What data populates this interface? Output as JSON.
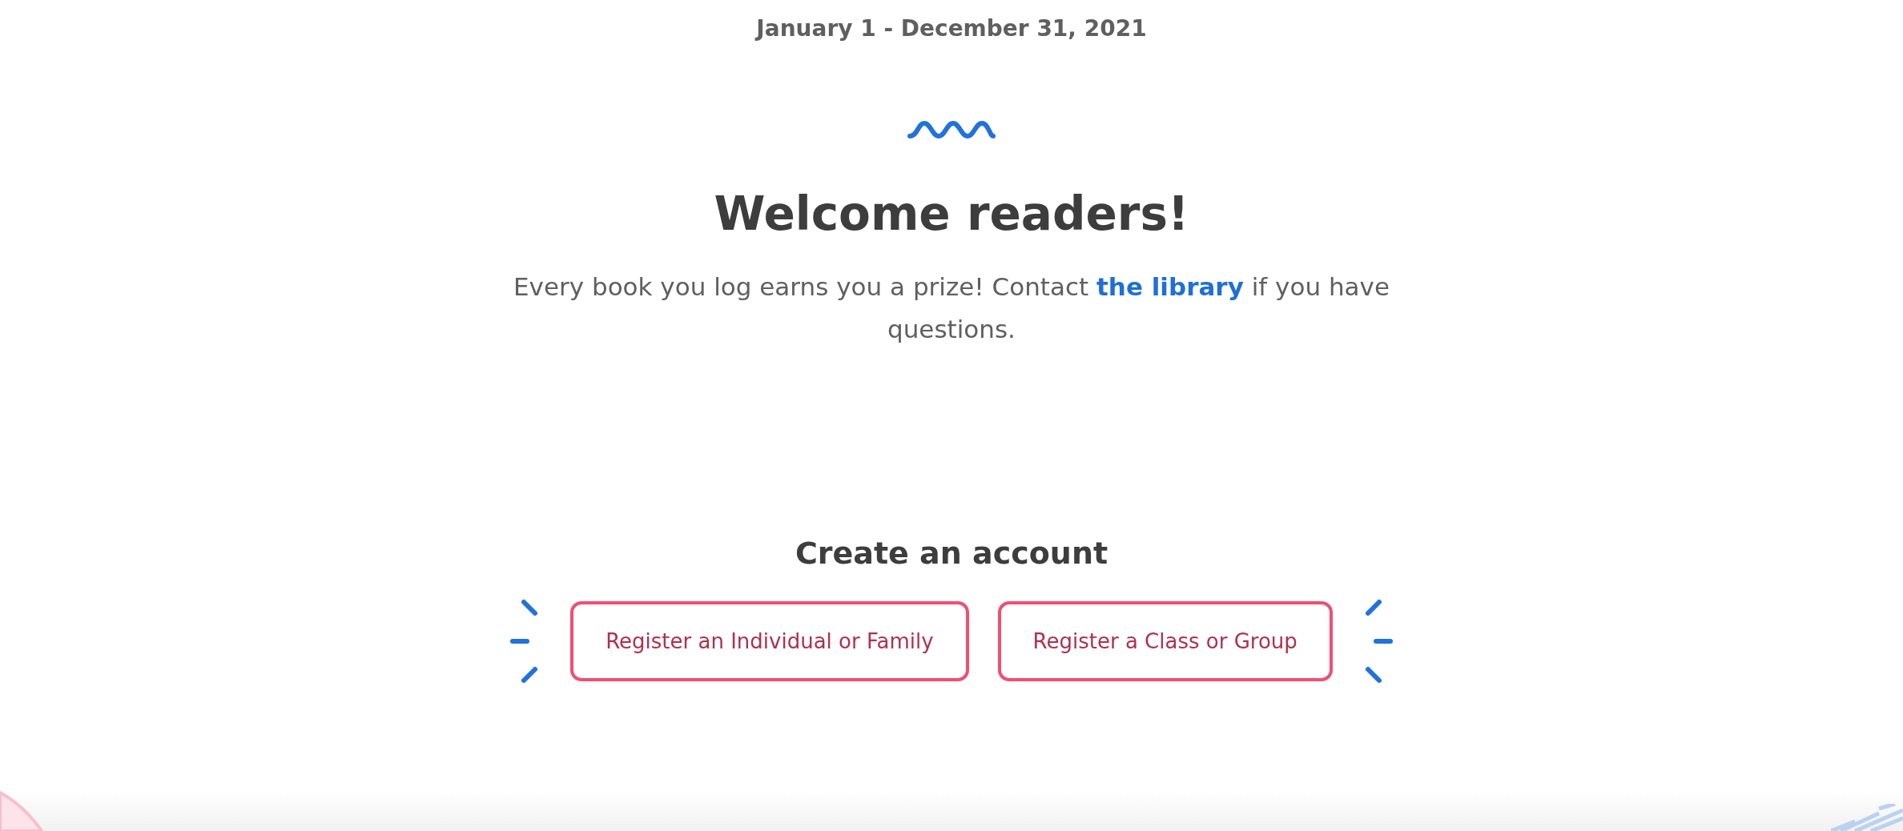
{
  "date_range": "January 1 - December 31, 2021",
  "heading": "Welcome readers!",
  "intro": {
    "before": "Every book you log earns you a prize! Contact ",
    "link": "the library",
    "after": " if you have questions."
  },
  "account": {
    "heading": "Create an account",
    "buttons": [
      "Register an Individual or Family",
      "Register a Class or Group"
    ]
  }
}
